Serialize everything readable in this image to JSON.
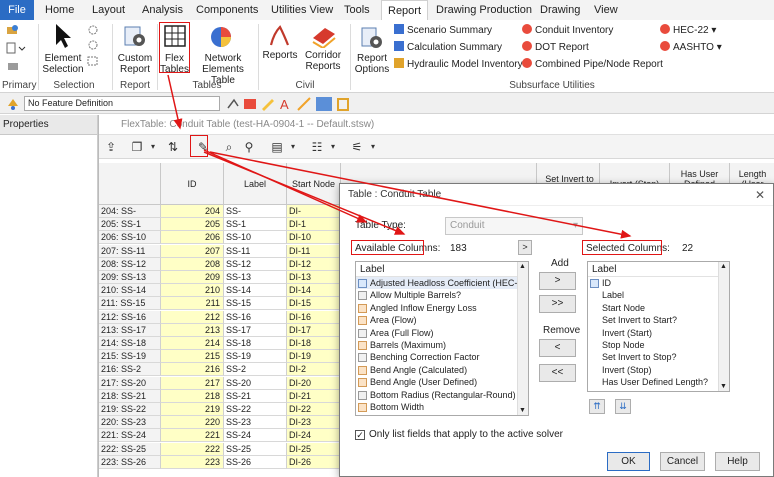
{
  "ribbon": {
    "tabs": [
      "File",
      "Home",
      "Layout",
      "Analysis",
      "Components",
      "Utilities View",
      "Tools",
      "Report",
      "Drawing Production",
      "Drawing",
      "View"
    ],
    "active_tab": "Report",
    "groups": [
      "Primary",
      "Selection",
      "Report",
      "Tables",
      "Civil",
      "Subsurface Utilities"
    ],
    "buttons": {
      "element_selection": "Element Selection",
      "custom_report": "Custom Report",
      "flex_tables": "Flex Tables",
      "network_elements_table": "Network Elements Table",
      "reports": "Reports",
      "corridor_reports": "Corridor Reports",
      "report_options": "Report Options"
    },
    "small_items": {
      "scenario_summary": "Scenario Summary",
      "calculation_summary": "Calculation Summary",
      "hydraulic_model_inventory": "Hydraulic Model Inventory",
      "conduit_inventory": "Conduit Inventory",
      "dot_report": "DOT Report",
      "combined_pipe_node_report": "Combined Pipe/Node Report",
      "hec22": "HEC-22",
      "aashto": "AASHTO"
    }
  },
  "feature_definition": "No Feature Definition",
  "properties_title": "Properties",
  "flextable": {
    "title": "FlexTable: Conduit Table (test-HA-0904-1 -- Default.stsw)",
    "columns": [
      "ID",
      "Label",
      "Start Node",
      "Set Invert to Start?",
      "Invert (Start)",
      "Stop Node",
      "Set Invert to Stop?",
      "Invert (Stop)",
      "Has User Defined Length?",
      "Length (User Defined)"
    ],
    "rows": [
      {
        "rn": "204: SS-",
        "id": "204",
        "label": "SS-",
        "start": "DI-"
      },
      {
        "rn": "205: SS-1",
        "id": "205",
        "label": "SS-1",
        "start": "DI-1"
      },
      {
        "rn": "206: SS-10",
        "id": "206",
        "label": "SS-10",
        "start": "DI-10"
      },
      {
        "rn": "207: SS-11",
        "id": "207",
        "label": "SS-11",
        "start": "DI-11"
      },
      {
        "rn": "208: SS-12",
        "id": "208",
        "label": "SS-12",
        "start": "DI-12"
      },
      {
        "rn": "209: SS-13",
        "id": "209",
        "label": "SS-13",
        "start": "DI-13"
      },
      {
        "rn": "210: SS-14",
        "id": "210",
        "label": "SS-14",
        "start": "DI-14"
      },
      {
        "rn": "211: SS-15",
        "id": "211",
        "label": "SS-15",
        "start": "DI-15"
      },
      {
        "rn": "212: SS-16",
        "id": "212",
        "label": "SS-16",
        "start": "DI-16"
      },
      {
        "rn": "213: SS-17",
        "id": "213",
        "label": "SS-17",
        "start": "DI-17"
      },
      {
        "rn": "214: SS-18",
        "id": "214",
        "label": "SS-18",
        "start": "DI-18"
      },
      {
        "rn": "215: SS-19",
        "id": "215",
        "label": "SS-19",
        "start": "DI-19"
      },
      {
        "rn": "216: SS-2",
        "id": "216",
        "label": "SS-2",
        "start": "DI-2"
      },
      {
        "rn": "217: SS-20",
        "id": "217",
        "label": "SS-20",
        "start": "DI-20"
      },
      {
        "rn": "218: SS-21",
        "id": "218",
        "label": "SS-21",
        "start": "DI-21"
      },
      {
        "rn": "219: SS-22",
        "id": "219",
        "label": "SS-22",
        "start": "DI-22"
      },
      {
        "rn": "220: SS-23",
        "id": "220",
        "label": "SS-23",
        "start": "DI-23"
      },
      {
        "rn": "221: SS-24",
        "id": "221",
        "label": "SS-24",
        "start": "DI-24"
      },
      {
        "rn": "222: SS-25",
        "id": "222",
        "label": "SS-25",
        "start": "DI-25"
      },
      {
        "rn": "223: SS-26",
        "id": "223",
        "label": "SS-26",
        "start": "DI-26"
      }
    ]
  },
  "dialog": {
    "title": "Table : Conduit Table",
    "table_type_label": "Table Type:",
    "table_type_value": "Conduit",
    "available_label": "Available Columns:",
    "available_count": "183",
    "selected_label": "Selected Columns:",
    "selected_count": "22",
    "list_header": "Label",
    "available_items": [
      "Adjusted Headloss Coefficient (HEC-...",
      "Allow Multiple Barrels?",
      "Angled Inflow Energy Loss",
      "Area (Flow)",
      "Area (Full Flow)",
      "Barrels (Maximum)",
      "Benching Correction Factor",
      "Bend Angle (Calculated)",
      "Bend Angle (User Defined)",
      "Bottom Radius (Rectangular-Round)",
      "Bottom Width"
    ],
    "selected_items": [
      "ID",
      "Label",
      "Start Node",
      "Set Invert to Start?",
      "Invert (Start)",
      "Stop Node",
      "Set Invert to Stop?",
      "Invert (Stop)",
      "Has User Defined Length?"
    ],
    "add_label": "Add",
    "remove_label": "Remove",
    "add_one": ">",
    "add_all": ">>",
    "remove_one": "<",
    "remove_all": "<<",
    "checkbox_label": "Only list fields that apply to the active solver",
    "ok": "OK",
    "cancel": "Cancel",
    "help": "Help"
  },
  "colors": {
    "file_tab": "#2b6cc4",
    "highlight_yellow": "#ffffc6",
    "annotation_red": "#e01616"
  }
}
